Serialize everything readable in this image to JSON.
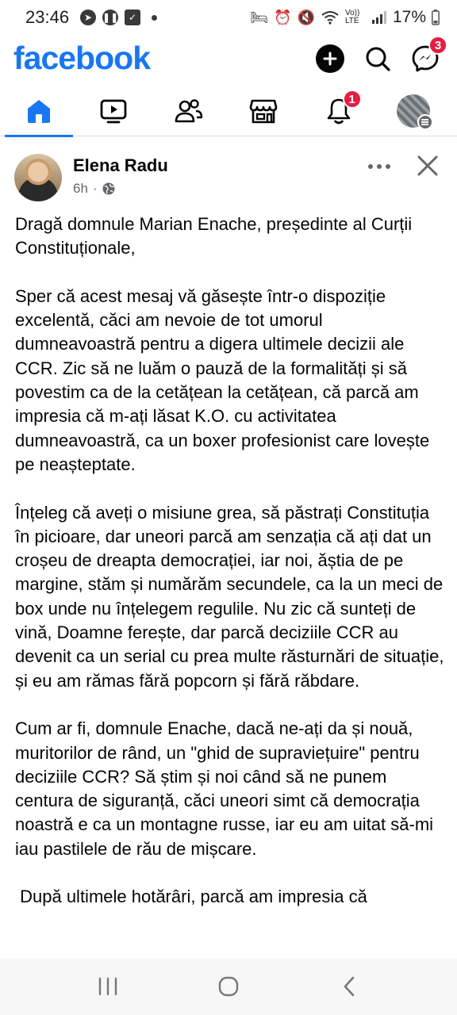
{
  "status_bar": {
    "time": "23:46",
    "battery": "17%",
    "network": "Vo)) LTE"
  },
  "header": {
    "logo": "facebook",
    "messenger_badge": "3"
  },
  "tabs": {
    "notifications_badge": "1"
  },
  "post": {
    "author": "Elena Radu",
    "time": "6h",
    "separator": "·",
    "paragraphs": [
      "Dragă domnule Marian Enache, președinte al Curții Constituționale,",
      "Sper că acest mesaj vă găsește într-o dispoziție excelentă, căci am nevoie de tot umorul dumneavoastră pentru a digera ultimele decizii ale CCR. Zic să ne luăm o pauză de la formalități și să povestim ca de la cetățean la cetățean, că parcă am impresia că m-ați lăsat K.O. cu activitatea dumneavoastră, ca un boxer profesionist care lovește pe neașteptate.",
      "Înțeleg că aveți o misiune grea, să păstrați Constituția în picioare, dar uneori parcă am senzația că ați dat un croșeu de dreapta democrației, iar noi, ăștia de pe margine, stăm și numărăm secundele, ca la un meci de box unde nu înțelegem regulile. Nu zic că sunteți de vină, Doamne ferește, dar parcă deciziile CCR au devenit ca un serial cu prea multe răsturnări de situație, și eu am rămas fără popcorn și fără răbdare.",
      "Cum ar fi, domnule Enache, dacă ne-ați da și nouă, muritorilor de rând, un \"ghid de supraviețuire\" pentru deciziile CCR? Să știm și noi când să ne punem centura de siguranță, căci uneori simt că democrația noastră e ca un montagne russe, iar eu am uitat să-mi iau pastilele de rău de mișcare.",
      " După ultimele hotărâri, parcă am impresia că"
    ]
  },
  "colors": {
    "brand": "#1877f2",
    "badge": "#e41e3f",
    "meta_text": "#65676b"
  }
}
